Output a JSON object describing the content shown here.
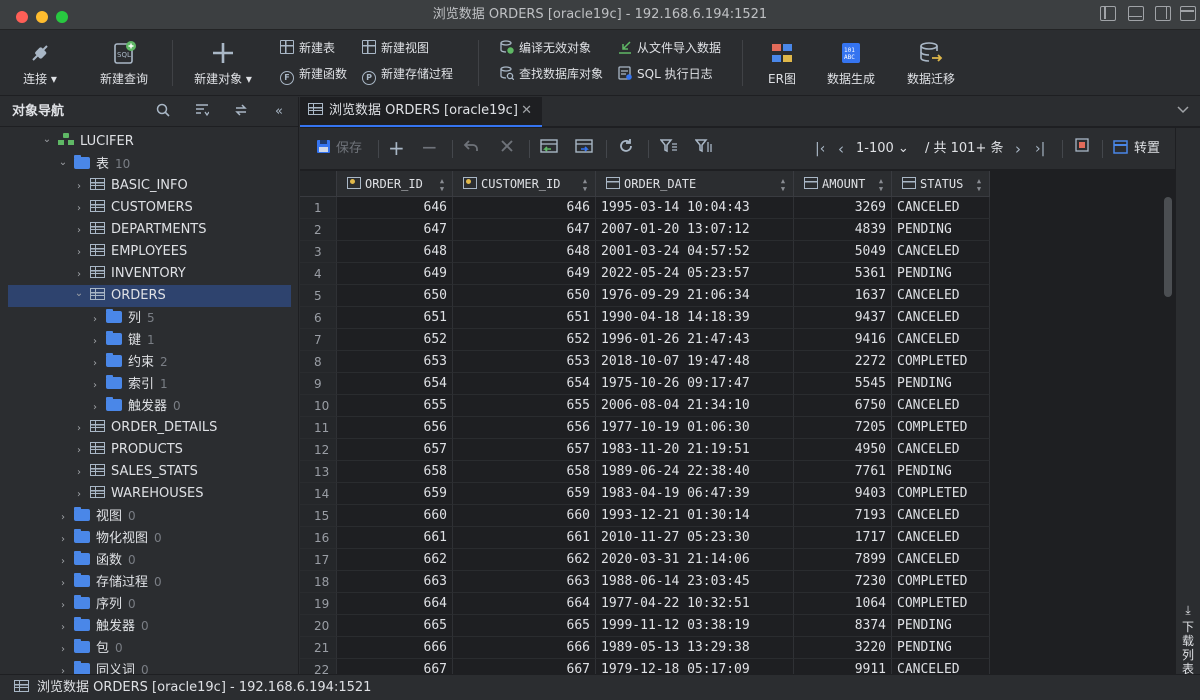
{
  "window": {
    "title": "浏览数据 ORDERS [oracle19c]  - 192.168.6.194:1521"
  },
  "toolbar": {
    "connect": "连接",
    "new_query": "新建查询",
    "new_object": "新建对象",
    "new_table": "新建表",
    "new_view": "新建视图",
    "new_function": "新建函数",
    "new_procedure": "新建存储过程",
    "compile_invalid": "编译无效对象",
    "find_db_object": "查找数据库对象",
    "import_from_file": "从文件导入数据",
    "sql_log": "SQL 执行日志",
    "er_diagram": "ER图",
    "data_generate": "数据生成",
    "data_migrate": "数据迁移"
  },
  "navigator": {
    "title": "对象导航",
    "schema": "LUCIFER",
    "tables_folder": {
      "label": "表",
      "count": "10"
    },
    "tables": [
      "BASIC_INFO",
      "CUSTOMERS",
      "DEPARTMENTS",
      "EMPLOYEES",
      "INVENTORY",
      "ORDERS",
      "ORDER_DETAILS",
      "PRODUCTS",
      "SALES_STATS",
      "WAREHOUSES"
    ],
    "orders_children": [
      {
        "label": "列",
        "count": "5"
      },
      {
        "label": "键",
        "count": "1"
      },
      {
        "label": "约束",
        "count": "2"
      },
      {
        "label": "索引",
        "count": "1"
      },
      {
        "label": "触发器",
        "count": "0"
      }
    ],
    "other_folders": [
      {
        "label": "视图",
        "count": "0"
      },
      {
        "label": "物化视图",
        "count": "0"
      },
      {
        "label": "函数",
        "count": "0"
      },
      {
        "label": "存储过程",
        "count": "0"
      },
      {
        "label": "序列",
        "count": "0"
      },
      {
        "label": "触发器",
        "count": "0"
      },
      {
        "label": "包",
        "count": "0"
      },
      {
        "label": "同义词",
        "count": "0"
      }
    ]
  },
  "tab": {
    "label": "浏览数据 ORDERS [oracle19c]",
    "close": "✕"
  },
  "data_toolbar": {
    "save": "保存",
    "page_range": "1-100",
    "total": "/ 共 101+ 条",
    "transpose": "转置"
  },
  "grid": {
    "columns": [
      "ORDER_ID",
      "CUSTOMER_ID",
      "ORDER_DATE",
      "AMOUNT",
      "STATUS"
    ],
    "rows": [
      [
        "1",
        "646",
        "646",
        "1995-03-14 10:04:43",
        "3269",
        "CANCELED"
      ],
      [
        "2",
        "647",
        "647",
        "2007-01-20 13:07:12",
        "4839",
        "PENDING"
      ],
      [
        "3",
        "648",
        "648",
        "2001-03-24 04:57:52",
        "5049",
        "CANCELED"
      ],
      [
        "4",
        "649",
        "649",
        "2022-05-24 05:23:57",
        "5361",
        "PENDING"
      ],
      [
        "5",
        "650",
        "650",
        "1976-09-29 21:06:34",
        "1637",
        "CANCELED"
      ],
      [
        "6",
        "651",
        "651",
        "1990-04-18 14:18:39",
        "9437",
        "CANCELED"
      ],
      [
        "7",
        "652",
        "652",
        "1996-01-26 21:47:43",
        "9416",
        "CANCELED"
      ],
      [
        "8",
        "653",
        "653",
        "2018-10-07 19:47:48",
        "2272",
        "COMPLETED"
      ],
      [
        "9",
        "654",
        "654",
        "1975-10-26 09:17:47",
        "5545",
        "PENDING"
      ],
      [
        "10",
        "655",
        "655",
        "2006-08-04 21:34:10",
        "6750",
        "CANCELED"
      ],
      [
        "11",
        "656",
        "656",
        "1977-10-19 01:06:30",
        "7205",
        "COMPLETED"
      ],
      [
        "12",
        "657",
        "657",
        "1983-11-20 21:19:51",
        "4950",
        "CANCELED"
      ],
      [
        "13",
        "658",
        "658",
        "1989-06-24 22:38:40",
        "7761",
        "PENDING"
      ],
      [
        "14",
        "659",
        "659",
        "1983-04-19 06:47:39",
        "9403",
        "COMPLETED"
      ],
      [
        "15",
        "660",
        "660",
        "1993-12-21 01:30:14",
        "7193",
        "CANCELED"
      ],
      [
        "16",
        "661",
        "661",
        "2010-11-27 05:23:30",
        "1717",
        "CANCELED"
      ],
      [
        "17",
        "662",
        "662",
        "2020-03-31 21:14:06",
        "7899",
        "CANCELED"
      ],
      [
        "18",
        "663",
        "663",
        "1988-06-14 23:03:45",
        "7230",
        "COMPLETED"
      ],
      [
        "19",
        "664",
        "664",
        "1977-04-22 10:32:51",
        "1064",
        "COMPLETED"
      ],
      [
        "20",
        "665",
        "665",
        "1999-11-12 03:38:19",
        "8374",
        "PENDING"
      ],
      [
        "21",
        "666",
        "666",
        "1989-05-13 13:29:38",
        "3220",
        "PENDING"
      ],
      [
        "22",
        "667",
        "667",
        "1979-12-18 05:17:09",
        "9911",
        "CANCELED"
      ]
    ]
  },
  "side_strip": {
    "download_list": "下载列表"
  },
  "statusbar": {
    "text": "浏览数据 ORDERS [oracle19c] - 192.168.6.194:1521"
  }
}
